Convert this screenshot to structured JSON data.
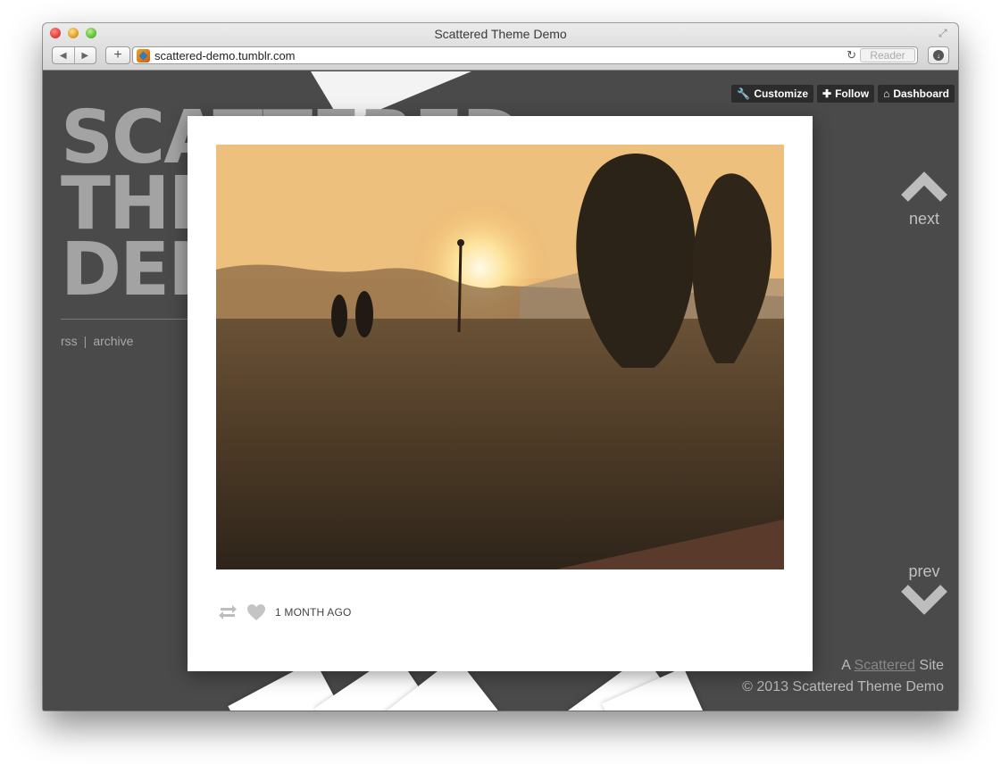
{
  "browser": {
    "window_title": "Scattered Theme Demo",
    "url": "scattered-demo.tumblr.com",
    "reader_label": "Reader"
  },
  "site": {
    "title_lines": [
      "SCATTERED",
      "THEME",
      "DEMO"
    ],
    "links": {
      "rss": "rss",
      "archive": "archive",
      "separator": "|"
    }
  },
  "tumblr_controls": {
    "customize": "Customize",
    "follow": "Follow",
    "dashboard": "Dashboard"
  },
  "navigation": {
    "next": "next",
    "prev": "prev"
  },
  "post": {
    "date": "1 MONTH AGO"
  },
  "footer": {
    "line1_prefix": "A",
    "line1_link": "Scattered",
    "line1_suffix": "Site",
    "line2": "© 2013 Scattered Theme Demo"
  },
  "colors": {
    "page_background": "#4a4a4a",
    "title_color": "#a3a3a3",
    "card_background": "#ffffff",
    "controls_background": "#2c2c2c"
  }
}
